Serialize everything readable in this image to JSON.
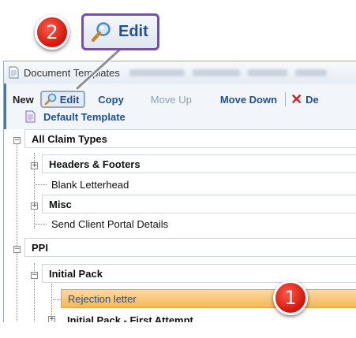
{
  "callouts": {
    "step_badge_1": "1",
    "step_badge_2": "2",
    "edit_label": "Edit"
  },
  "window": {
    "title": "Document Templates"
  },
  "toolbar": {
    "new_label": "New",
    "edit_label": "Edit",
    "copy_label": "Copy",
    "move_up_label": "Move Up",
    "move_down_label": "Move Down",
    "delete_label": "De",
    "default_template_label": "Default Template"
  },
  "tree": {
    "all_claim_types": "All Claim Types",
    "headers_footers": "Headers & Footers",
    "blank_letterhead": "Blank Letterhead",
    "misc": "Misc",
    "send_client_portal": "Send Client Portal Details",
    "ppi": "PPI",
    "initial_pack": "Initial Pack",
    "rejection_letter": "Rejection letter",
    "initial_pack_first": "Initial Pack - First Attempt"
  },
  "colors": {
    "callout_border": "#7b47c8",
    "badge_red": "#d0150a",
    "selection_orange": "#f7b659",
    "link_blue": "#1f4f96"
  }
}
